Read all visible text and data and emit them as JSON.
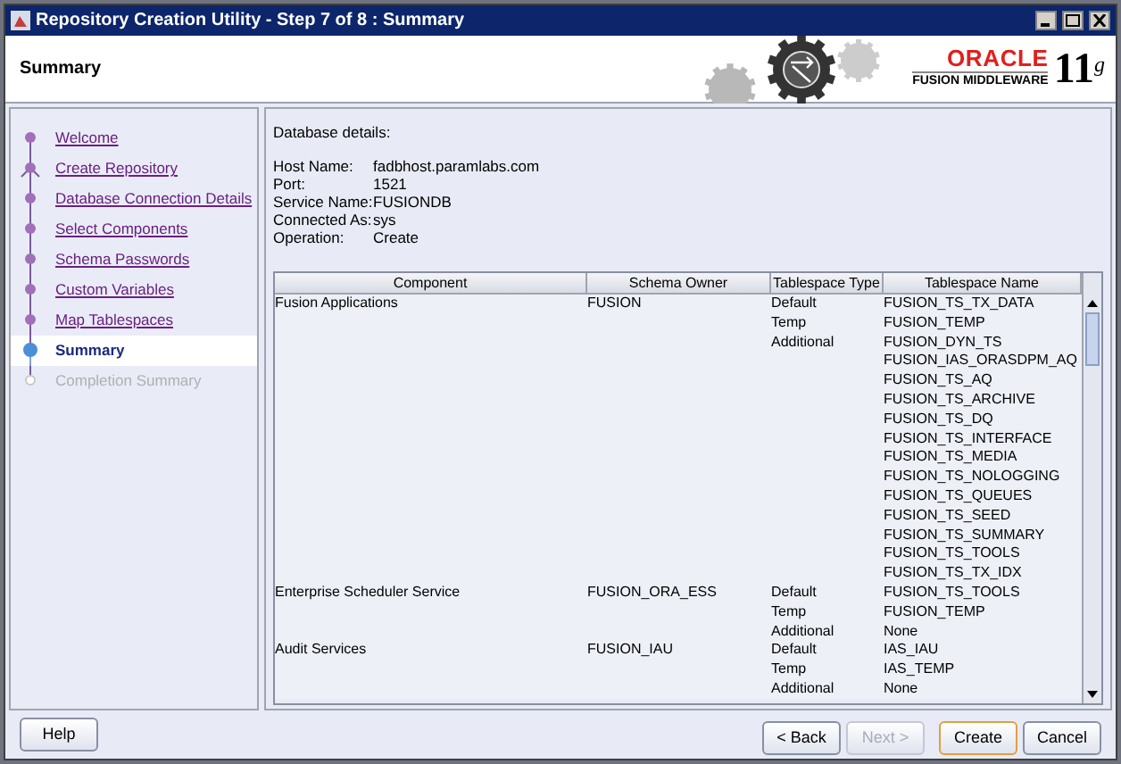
{
  "window": {
    "title": "Repository Creation Utility - Step 7 of 8 : Summary"
  },
  "header": {
    "title": "Summary",
    "brand": "ORACLE",
    "product": "FUSION MIDDLEWARE",
    "version": "11",
    "version_sup": "g"
  },
  "steps": [
    {
      "label": "Welcome",
      "kind": "done",
      "selected": false
    },
    {
      "label": "Create Repository",
      "kind": "branch",
      "selected": false
    },
    {
      "label": "Database Connection Details",
      "kind": "done",
      "selected": false
    },
    {
      "label": "Select Components",
      "kind": "done",
      "selected": false
    },
    {
      "label": "Schema Passwords",
      "kind": "done",
      "selected": false
    },
    {
      "label": "Custom Variables",
      "kind": "done",
      "selected": false
    },
    {
      "label": "Map Tablespaces",
      "kind": "done",
      "selected": false
    },
    {
      "label": "Summary",
      "kind": "current",
      "selected": true
    },
    {
      "label": "Completion Summary",
      "kind": "pending",
      "selected": false
    }
  ],
  "details": {
    "heading": "Database details:",
    "fields": [
      {
        "label": "Host Name:",
        "value": "fadbhost.paramlabs.com"
      },
      {
        "label": "Port:",
        "value": "1521"
      },
      {
        "label": "Service Name:",
        "value": "FUSIONDB"
      },
      {
        "label": "Connected As:",
        "value": "sys"
      },
      {
        "label": "Operation:",
        "value": "Create"
      }
    ]
  },
  "table": {
    "columns": [
      "Component",
      "Schema Owner",
      "Tablespace Type",
      "Tablespace Name"
    ],
    "rows": [
      {
        "component": "Fusion Applications",
        "schema_owner": "FUSION",
        "tablespaces": [
          {
            "type": "Default",
            "name": "FUSION_TS_TX_DATA"
          },
          {
            "type": "Temp",
            "name": "FUSION_TEMP"
          },
          {
            "type": "Additional",
            "name": "FUSION_DYN_TS"
          },
          {
            "name": "FUSION_IAS_ORASDPM_AQ"
          },
          {
            "name": "FUSION_TS_AQ"
          },
          {
            "name": "FUSION_TS_ARCHIVE"
          },
          {
            "name": "FUSION_TS_DQ"
          },
          {
            "name": "FUSION_TS_INTERFACE"
          },
          {
            "name": "FUSION_TS_MEDIA"
          },
          {
            "name": "FUSION_TS_NOLOGGING"
          },
          {
            "name": "FUSION_TS_QUEUES"
          },
          {
            "name": "FUSION_TS_SEED"
          },
          {
            "name": "FUSION_TS_SUMMARY"
          },
          {
            "name": "FUSION_TS_TOOLS"
          },
          {
            "name": "FUSION_TS_TX_IDX"
          }
        ]
      },
      {
        "component": "Enterprise Scheduler Service",
        "schema_owner": "FUSION_ORA_ESS",
        "tablespaces": [
          {
            "type": "Default",
            "name": "FUSION_TS_TOOLS"
          },
          {
            "type": "Temp",
            "name": "FUSION_TEMP"
          },
          {
            "type": "Additional",
            "name": "None"
          }
        ]
      },
      {
        "component": "Audit Services",
        "schema_owner": "FUSION_IAU",
        "tablespaces": [
          {
            "type": "Default",
            "name": "IAS_IAU"
          },
          {
            "type": "Temp",
            "name": "IAS_TEMP"
          },
          {
            "type": "Additional",
            "name": "None"
          }
        ]
      }
    ]
  },
  "help_button": {
    "label": "Help",
    "disabled": false,
    "default": false
  },
  "buttons": [
    {
      "label": "< Back",
      "disabled": false,
      "default": false
    },
    {
      "label": "Next >",
      "disabled": true,
      "default": false
    },
    {
      "label": "Create",
      "disabled": false,
      "default": true
    },
    {
      "label": "Cancel",
      "disabled": false,
      "default": false
    }
  ]
}
